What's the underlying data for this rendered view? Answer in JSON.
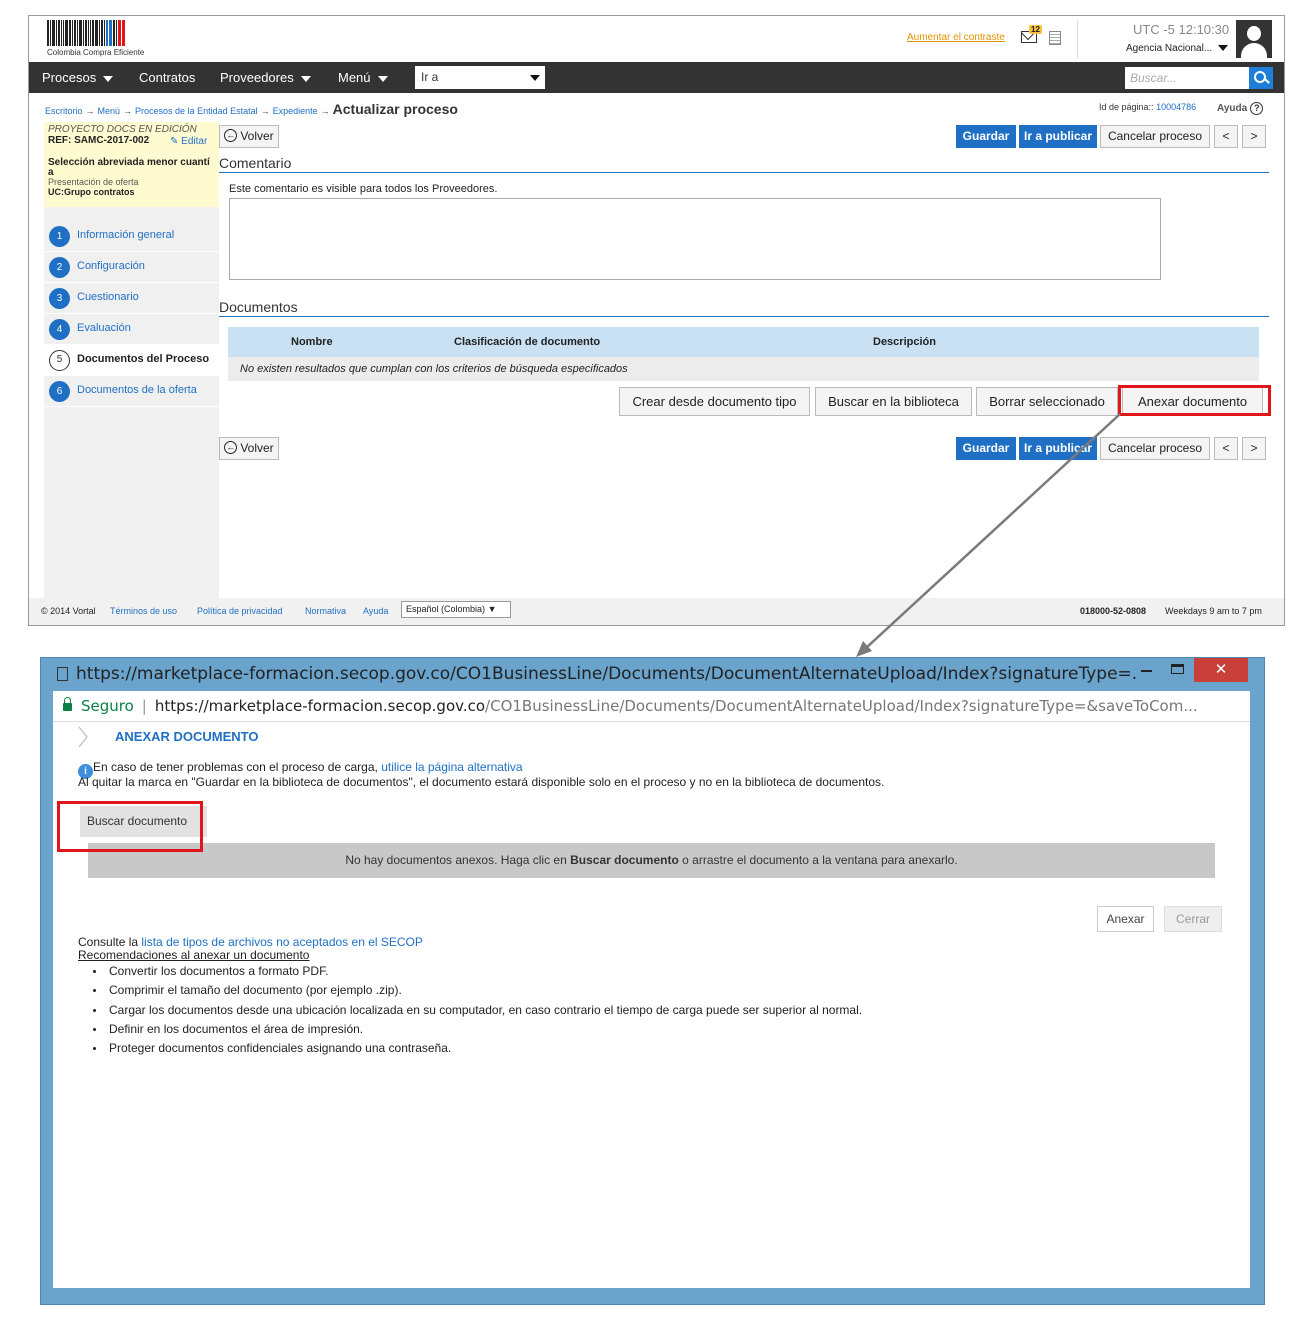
{
  "top": {
    "logo_caption": "Colombia Compra Eficiente",
    "contrast_link": "Aumentar el contraste",
    "mail_badge": "12",
    "utc": "UTC -5 12:10:30",
    "agency": "Agencia Nacional...",
    "nav": {
      "procesos": "Procesos",
      "contratos": "Contratos",
      "proveedores": "Proveedores",
      "menu": "Menú",
      "goto": "Ir a",
      "search_placeholder": "Buscar..."
    },
    "breadcrumb": [
      "Escritorio",
      "Menú",
      "Procesos de la Entidad Estatal",
      "Expediente"
    ],
    "breadcrumb_current": "Actualizar proceso",
    "page_id_label": "Id de página::",
    "page_id": "10004786",
    "help": "Ayuda",
    "project": {
      "status": "PROYECTO DOCS EN EDICIÓN",
      "ref": "REF: SAMC-2017-002",
      "edit": "Editar",
      "modality_1": "Selección abreviada menor cuantí",
      "modality_2": "a",
      "phase": "Presentación de oferta",
      "uc": "UC:Grupo contratos"
    },
    "steps": [
      {
        "num": "1",
        "label": "Información general"
      },
      {
        "num": "2",
        "label": "Configuración"
      },
      {
        "num": "3",
        "label": "Cuestionario"
      },
      {
        "num": "4",
        "label": "Evaluación"
      },
      {
        "num": "5",
        "label": "Documentos del Proceso"
      },
      {
        "num": "6",
        "label": "Documentos de la oferta"
      }
    ],
    "buttons": {
      "back": "Volver",
      "save": "Guardar",
      "publish": "Ir a publicar",
      "cancel": "Cancelar proceso",
      "prev": "<",
      "next": ">"
    },
    "comment_title": "Comentario",
    "comment_note": "Este comentario es visible para todos los Proveedores.",
    "docs_title": "Documentos",
    "table": {
      "columns": [
        "Nombre",
        "Clasificación de documento",
        "Descripción"
      ],
      "empty": "No existen resultados que cumplan con los criterios de búsqueda especificados"
    },
    "doc_buttons": {
      "template": "Crear desde documento tipo",
      "library": "Buscar en la biblioteca",
      "delete": "Borrar seleccionado",
      "attach": "Anexar documento"
    },
    "footer": {
      "copyright": "© 2014 Vortal",
      "links": [
        "Términos de uso",
        "Política de privacidad",
        "Normativa",
        "Ayuda"
      ],
      "language": "Español (Colombia)",
      "phone": "018000-52-0808",
      "hours": "Weekdays 9 am to 7 pm"
    }
  },
  "popup": {
    "window_title": "https://marketplace-formacion.secop.gov.co/CO1BusinessLine/Documents/DocumentAlternateUpload/Index?signatureType=...",
    "close": "✕",
    "secure": "Seguro",
    "url_scheme": "https://",
    "url_host": "marketplace-formacion.secop.gov.co",
    "url_path": "/CO1BusinessLine/Documents/DocumentAlternateUpload/Index?signatureType=&saveToCom...",
    "heading": "ANEXAR DOCUMENTO",
    "info_text": "En caso de tener problemas con el proceso de carga,",
    "info_link": "utilice la página alternativa",
    "info_text2": "Al quitar la marca en \"Guardar en la biblioteca de documentos\", el documento estará disponible solo en el proceso y no en la biblioteca de documentos.",
    "browse_button": "Buscar documento",
    "no_docs_prefix": "No hay documentos anexos. Haga clic en",
    "no_docs_bold": "Buscar documento",
    "no_docs_suffix": "o arrastre el documento a la ventana para anexarlo.",
    "attach_button": "Anexar",
    "close_button": "Cerrar",
    "consult_text": "Consulte la",
    "consult_link": "lista de tipos de archivos no aceptados en el SECOP",
    "recommend_title": "Recomendaciones al anexar un documento",
    "recommendations": [
      "Convertir los documentos a formato PDF.",
      "Comprimir el tamaño del documento (por ejemplo .zip).",
      "Cargar los documentos desde una ubicación localizada en su computador, en caso contrario el tiempo de carga puede ser superior al normal.",
      "Definir en los documentos el área de impresión.",
      "Proteger documentos confidenciales asignando una contraseña."
    ]
  },
  "colors": {
    "brand_blue": "#1f6fc4",
    "nav_dark": "#333333",
    "highlight_red": "#e0161b",
    "popup_frame": "#6aa3cc"
  }
}
